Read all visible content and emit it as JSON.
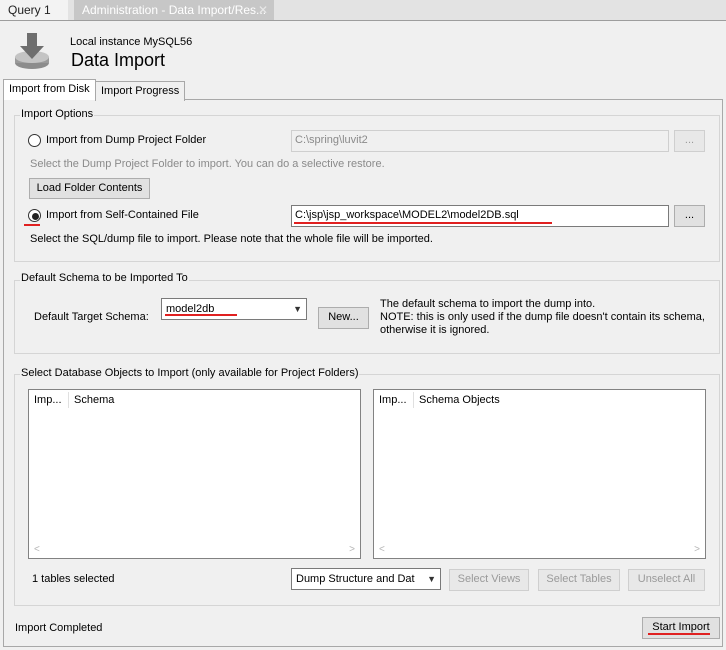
{
  "doc_tabs": [
    {
      "label": "Query 1"
    },
    {
      "label": "Administration - Data Import/Res..."
    }
  ],
  "header": {
    "instance": "Local instance MySQL56",
    "title": "Data Import",
    "icon": "import-arrow-icon"
  },
  "page_tabs": [
    {
      "label": "Import from Disk"
    },
    {
      "label": "Import Progress"
    }
  ],
  "import_options": {
    "group_label": "Import Options",
    "dump_folder_label": "Import from Dump Project Folder",
    "dump_folder_path": "C:\\spring\\luvit2",
    "browse1": "...",
    "dump_folder_hint": "Select the Dump Project Folder to import. You can do a selective restore.",
    "load_folder_button": "Load Folder Contents",
    "self_contained_label": "Import from Self-Contained File",
    "self_contained_path": "C:\\jsp\\jsp_workspace\\MODEL2\\model2DB.sql",
    "browse2": "...",
    "self_contained_hint": "Select the SQL/dump file to import. Please note that the whole file will be imported."
  },
  "default_schema": {
    "group_label": "Default Schema to be Imported To",
    "target_label": "Default Target Schema:",
    "selected": "model2db",
    "new_button": "New...",
    "note_line1": "The default schema to import the dump into.",
    "note_line2": "NOTE: this is only used if the dump file doesn't contain its schema,",
    "note_line3": "otherwise it is ignored."
  },
  "objects": {
    "group_label": "Select Database Objects to Import (only available for Project Folders)",
    "left_cols": [
      "Imp...",
      "Schema"
    ],
    "right_cols": [
      "Imp...",
      "Schema Objects"
    ],
    "status": "1 tables selected",
    "dump_option": "Dump Structure and Dat",
    "select_views": "Select Views",
    "select_tables": "Select Tables",
    "unselect_all": "Unselect All"
  },
  "footer": {
    "status": "Import Completed",
    "start_button": "Start Import"
  },
  "colors": {
    "underline": "#e02020"
  }
}
